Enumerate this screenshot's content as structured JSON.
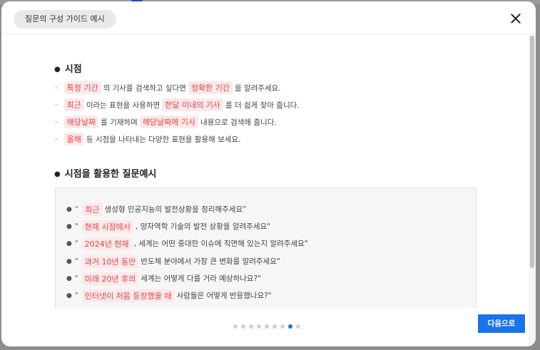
{
  "modal": {
    "title": "질문의 구성 가이드 예시",
    "next_label": "다음으로",
    "close_label": "×"
  },
  "sections": [
    {
      "title": "시점",
      "bullets": [
        {
          "parts": [
            {
              "hl": "특정 기간"
            },
            {
              "t": "의 기사를 검색하고 싶다면"
            },
            {
              "hl": "정확한 기간"
            },
            {
              "t": "을 알려주세요."
            }
          ]
        },
        {
          "parts": [
            {
              "hl": "최근"
            },
            {
              "t": "이라는 표현을 사용하면"
            },
            {
              "hl": "한달 이내의 기사"
            },
            {
              "t": "를 더 쉽게 찾아 줍니다."
            }
          ]
        },
        {
          "parts": [
            {
              "hl": "해당날짜"
            },
            {
              "t": "를 기재하며"
            },
            {
              "hl": "해당날짜에 기사"
            },
            {
              "t": "내용으로 검색해 줍니다."
            }
          ]
        },
        {
          "parts": [
            {
              "hl": "올해"
            },
            {
              "t": "등 시점을 나타내는 다양한 표현을 활용해 보세요."
            }
          ]
        }
      ]
    },
    {
      "title": "시점을 활용한 질문예시",
      "examples": [
        {
          "open": "“",
          "hl": "최근",
          "t": "생성형 인공지능의 발전상황을 정리해주세요”"
        },
        {
          "open": "\"",
          "hl": "현재 시점에서",
          "t": ", 양자역학 기술의 발전 상황을 알려주세요\""
        },
        {
          "open": "\"",
          "hl": "2024년 현재",
          "t": ", 세계는 어떤 중대한 이슈에 직면해 있는지 알려주세요\""
        },
        {
          "open": "\"",
          "hl": "과거 10년 동안",
          "t": "반도체 분야에서 가장 큰 변화를 알려주세요\""
        },
        {
          "open": "\"",
          "hl": "미래 20년 후의",
          "t": "세계는 어떻게 다를 거라 예상하나요?\""
        },
        {
          "open": "\"",
          "hl": "인터넷이 처음 등장했을 때",
          "t": "사람들은 어떻게 반응했나요?\""
        }
      ]
    }
  ],
  "pagination": {
    "count": 9,
    "active_index": 7
  },
  "colors": {
    "accent": "#1a73e8",
    "highlight_text": "#e0444e",
    "highlight_bg": "#fde9e9"
  }
}
